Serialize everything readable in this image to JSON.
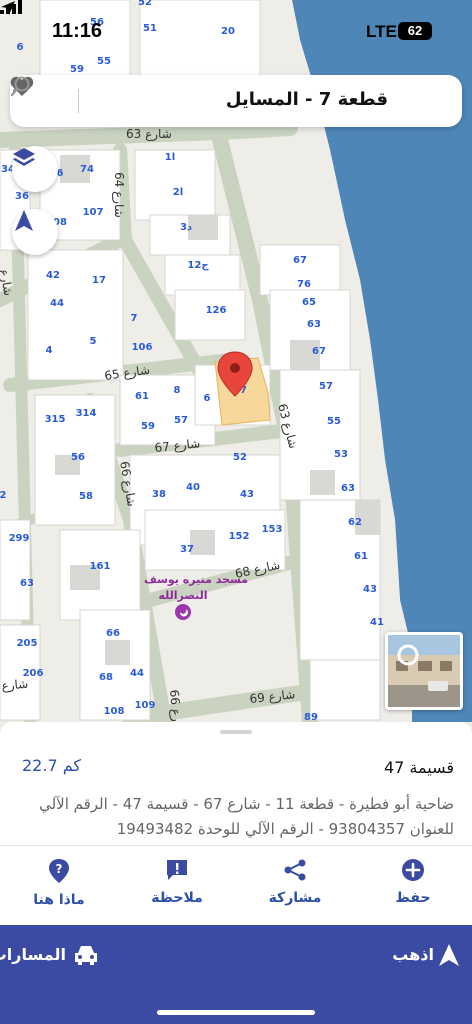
{
  "status_bar": {
    "time": "11:16",
    "network": "LTE",
    "battery": "62"
  },
  "search": {
    "query": "قطعة 7 - المسايل"
  },
  "map": {
    "colors": {
      "sea": "#4f86b8",
      "road": "#c9d3c0",
      "road_edge": "#b7c2ae",
      "land": "#eeede8",
      "block": "#ffffff",
      "selected": "#f7d79a",
      "pin": "#e8453c"
    },
    "streets": {
      "s63_top": "شارع 63",
      "s64": "شارع 64",
      "s65": "شارع 65",
      "s67": "شارع 67",
      "s63_right": "شارع 63",
      "s66": "شارع 66",
      "s68": "شارع 68",
      "s69": "شارع 69",
      "s66_bottom": "شارع 66",
      "left_a": "شارع",
      "left_b": "شارع"
    },
    "plots": {
      "p56a": "56",
      "p52a": "52",
      "p51": "51",
      "p20": "20",
      "p59": "59",
      "p55": "55",
      "p6top": "6",
      "p74": "74",
      "p34": "34",
      "p6b": "6",
      "p36": "36",
      "p107": "107",
      "p108": "08",
      "pa1": "ا1",
      "pa2": "ا2",
      "pd3": "د3",
      "pj12": "ج12",
      "p126": "126",
      "p42": "42",
      "p17": "17",
      "p44": "44",
      "p7": "7",
      "p4": "4",
      "p5": "5",
      "p106": "106",
      "p67a": "67",
      "p76": "76",
      "p65": "65",
      "p63a": "63",
      "p67b": "67",
      "p57a": "57",
      "p55b": "55",
      "p53": "53",
      "p63b": "63",
      "p62": "62",
      "p61": "61",
      "p43a": "43",
      "p41": "41",
      "p61b": "61",
      "p8": "8",
      "p6c": "6",
      "p47": "47",
      "p59b": "59",
      "p57b": "57",
      "p315": "315",
      "p314": "314",
      "p56b": "56",
      "p58": "58",
      "p52b": "52",
      "p38": "38",
      "p40": "40",
      "p43b": "43",
      "p153": "153",
      "p152": "152",
      "p37": "37",
      "p299": "299",
      "p2": "2",
      "p63c": "63",
      "p161": "161",
      "p205": "205",
      "p206": "206",
      "p66": "66",
      "p68": "68",
      "p44b": "44",
      "p108b": "108",
      "p109": "109",
      "p89": "89"
    },
    "poi": {
      "line1": "مسجد منيره يوسف",
      "line2": "النصرالله"
    }
  },
  "sheet": {
    "title": "قسيمة 47",
    "distance": "22.7 كم",
    "address": "ضاحية أبو فطيرة - قطعة 11 - شارع 67 - قسيمة 47 - الرقم الآلي للعنوان 93804357 - الرقم الآلي للوحدة 19493482",
    "actions": {
      "save": "حفظ",
      "share": "مشاركة",
      "note": "ملاحظة",
      "what": "ماذا هنا"
    },
    "go": "اذهب",
    "routes": "المسارات"
  },
  "icons": [
    "location-arrow-icon",
    "signal-icon",
    "battery-icon",
    "search-icon",
    "heart-icon",
    "close-icon",
    "layers-icon",
    "navigation-arrow-icon",
    "map-pin-icon",
    "mosque-icon",
    "plus-circle-icon",
    "share-icon",
    "note-icon",
    "question-pin-icon",
    "car-icon"
  ]
}
